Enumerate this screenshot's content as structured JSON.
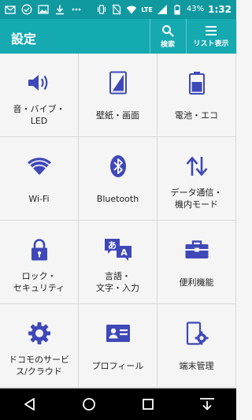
{
  "status_bar": {
    "battery": "43%",
    "time": "1:32",
    "network": "LTE"
  },
  "app_bar": {
    "title": "設定",
    "search_label": "検索",
    "list_label": "リスト表示"
  },
  "tiles": [
    {
      "label": "音・バイブ・\nLED",
      "icon": "volume-icon"
    },
    {
      "label": "壁紙・画面",
      "icon": "wallpaper-icon"
    },
    {
      "label": "電池・エコ",
      "icon": "battery-icon"
    },
    {
      "label": "Wi-Fi",
      "icon": "wifi-icon"
    },
    {
      "label": "Bluetooth",
      "icon": "bluetooth-icon"
    },
    {
      "label": "データ通信・\n機内モード",
      "icon": "data-transfer-icon"
    },
    {
      "label": "ロック・\nセキュリティ",
      "icon": "lock-icon"
    },
    {
      "label": "言語・\n文字・入力",
      "icon": "language-icon"
    },
    {
      "label": "便利機能",
      "icon": "toolbox-icon"
    },
    {
      "label": "ドコモのサービ\nス/クラウド",
      "icon": "gear-icon"
    },
    {
      "label": "プロフィール",
      "icon": "profile-card-icon"
    },
    {
      "label": "端末管理",
      "icon": "device-settings-icon"
    }
  ],
  "colors": {
    "status_bar": "#1199a0",
    "app_bar": "#15a9b0",
    "icon": "#3f48b8"
  }
}
